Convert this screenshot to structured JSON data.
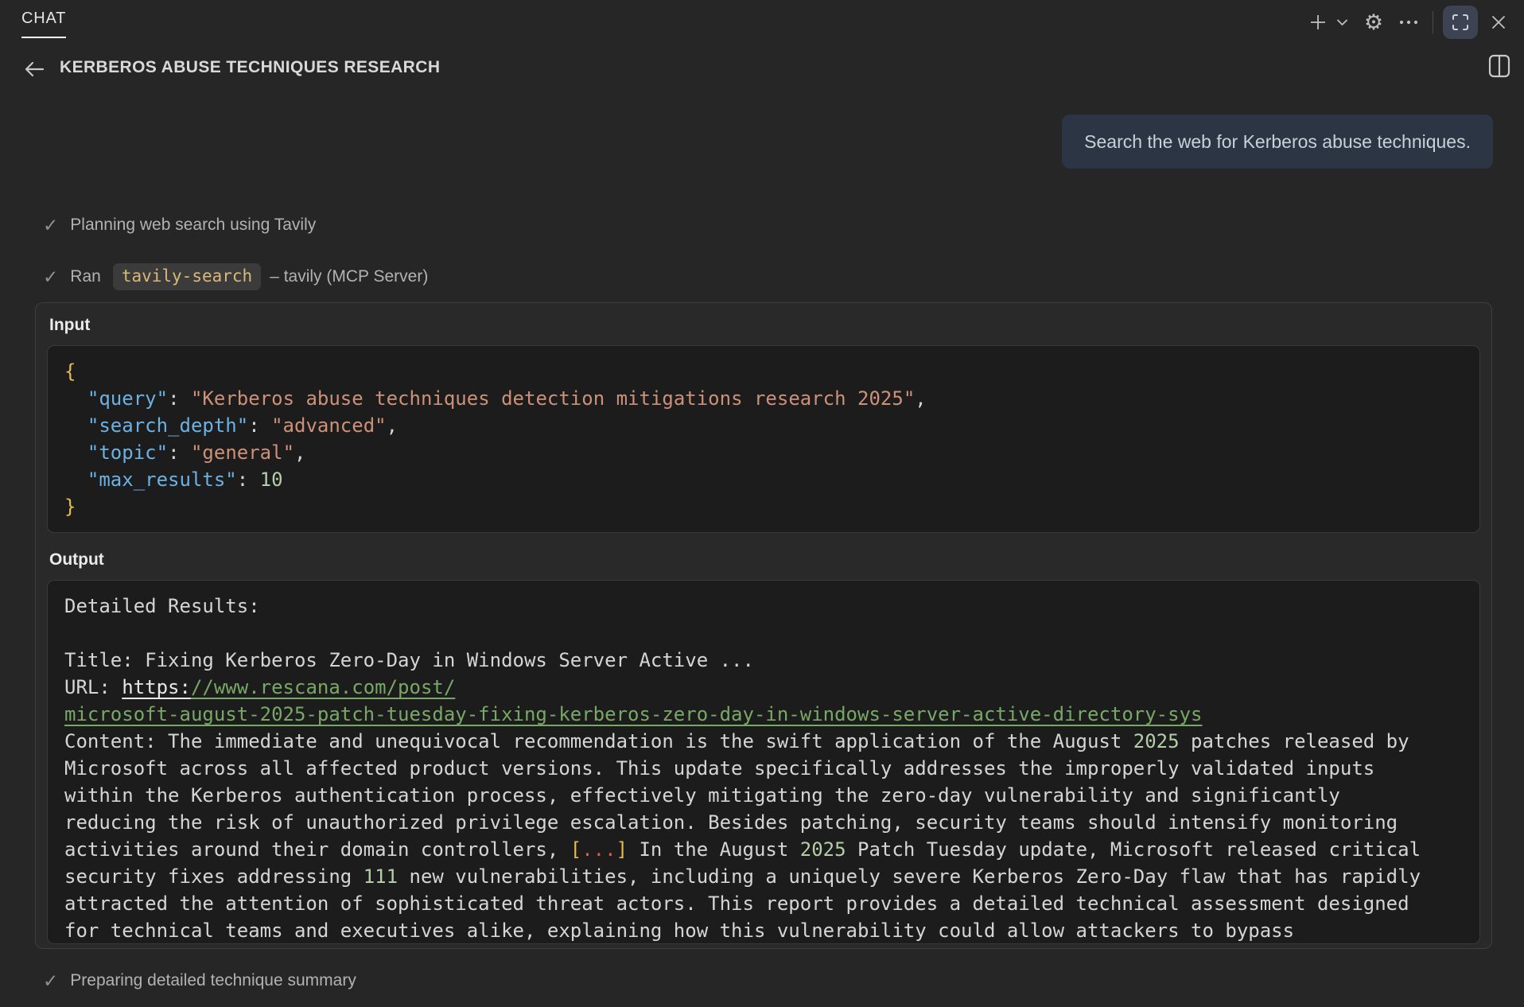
{
  "header": {
    "tab": "CHAT",
    "title": "KERBEROS ABUSE TECHNIQUES RESEARCH"
  },
  "user_message": {
    "text": "Search the web for Kerberos abuse techniques."
  },
  "steps": [
    {
      "label": "Planning web search using Tavily"
    },
    {
      "prefix": "Ran",
      "chip": "tavily-search",
      "suffix": "– tavily (MCP Server)"
    },
    {
      "label": "Preparing detailed technique summary"
    }
  ],
  "tool_card": {
    "input_label": "Input",
    "output_label": "Output",
    "input_lines": [
      [
        {
          "t": "{",
          "s": "b"
        }
      ],
      [
        {
          "t": "  ",
          "s": "p"
        },
        {
          "t": "\"query\"",
          "s": "k"
        },
        {
          "t": ": ",
          "s": "p"
        },
        {
          "t": "\"Kerberos abuse techniques detection mitigations research 2025\"",
          "s": "s"
        },
        {
          "t": ",",
          "s": "p"
        }
      ],
      [
        {
          "t": "  ",
          "s": "p"
        },
        {
          "t": "\"search_depth\"",
          "s": "k"
        },
        {
          "t": ": ",
          "s": "p"
        },
        {
          "t": "\"advanced\"",
          "s": "s"
        },
        {
          "t": ",",
          "s": "p"
        }
      ],
      [
        {
          "t": "  ",
          "s": "p"
        },
        {
          "t": "\"topic\"",
          "s": "k"
        },
        {
          "t": ": ",
          "s": "p"
        },
        {
          "t": "\"general\"",
          "s": "s"
        },
        {
          "t": ",",
          "s": "p"
        }
      ],
      [
        {
          "t": "  ",
          "s": "p"
        },
        {
          "t": "\"max_results\"",
          "s": "k"
        },
        {
          "t": ": ",
          "s": "p"
        },
        {
          "t": "10",
          "s": "n"
        }
      ],
      [
        {
          "t": "}",
          "s": "b"
        }
      ]
    ],
    "output_lines": [
      [
        {
          "t": "Detailed Results:",
          "s": "p"
        }
      ],
      [],
      [
        {
          "t": "Title: Fixing Kerberos Zero-Day in Windows Server Active ...",
          "s": "p"
        }
      ],
      [
        {
          "t": "URL: ",
          "s": "p"
        },
        {
          "t": "https:",
          "s": "lw"
        },
        {
          "t": "//www.rescana.com/post/",
          "s": "lg"
        }
      ],
      [
        {
          "t": "microsoft-august-2025-patch-tuesday-fixing-kerberos-zero-day-in-windows-server-active-directory-sys",
          "s": "lg"
        }
      ],
      [
        {
          "t": "Content: The immediate and unequivocal recommendation is the swift application of the August ",
          "s": "p"
        },
        {
          "t": "2025",
          "s": "n"
        },
        {
          "t": " patches released by",
          "s": "p"
        }
      ],
      [
        {
          "t": "Microsoft across all affected product versions. This update specifically addresses the improperly validated inputs",
          "s": "p"
        }
      ],
      [
        {
          "t": "within the Kerberos authentication process, effectively mitigating the zero-day vulnerability and significantly",
          "s": "p"
        }
      ],
      [
        {
          "t": "reducing the risk of unauthorized privilege escalation. Besides patching, security teams should intensify monitoring",
          "s": "p"
        }
      ],
      [
        {
          "t": "activities around their domain controllers, ",
          "s": "p"
        },
        {
          "t": "[",
          "s": "yb"
        },
        {
          "t": "...",
          "s": "rd"
        },
        {
          "t": "]",
          "s": "yb"
        },
        {
          "t": " In the August ",
          "s": "p"
        },
        {
          "t": "2025",
          "s": "n"
        },
        {
          "t": " Patch Tuesday update, Microsoft released critical",
          "s": "p"
        }
      ],
      [
        {
          "t": "security fixes addressing ",
          "s": "p"
        },
        {
          "t": "111",
          "s": "n"
        },
        {
          "t": " new vulnerabilities, including a uniquely severe Kerberos Zero-Day flaw that has rapidly",
          "s": "p"
        }
      ],
      [
        {
          "t": "attracted the attention of sophisticated threat actors. This report provides a detailed technical assessment designed",
          "s": "p"
        }
      ],
      [
        {
          "t": "for technical teams and executives alike, explaining how this vulnerability could allow attackers to bypass",
          "s": "p"
        }
      ]
    ]
  },
  "colors": {
    "background": "#262626",
    "card": "#292929",
    "code_block": "#1c1c1d",
    "bubble": "#2b3544",
    "accent_key": "#6cb1e3",
    "accent_string": "#cd9178",
    "accent_brace": "#e3bc4c",
    "accent_number": "#b5cea8",
    "accent_link": "#78a865",
    "chip_text": "#d9b87a"
  }
}
